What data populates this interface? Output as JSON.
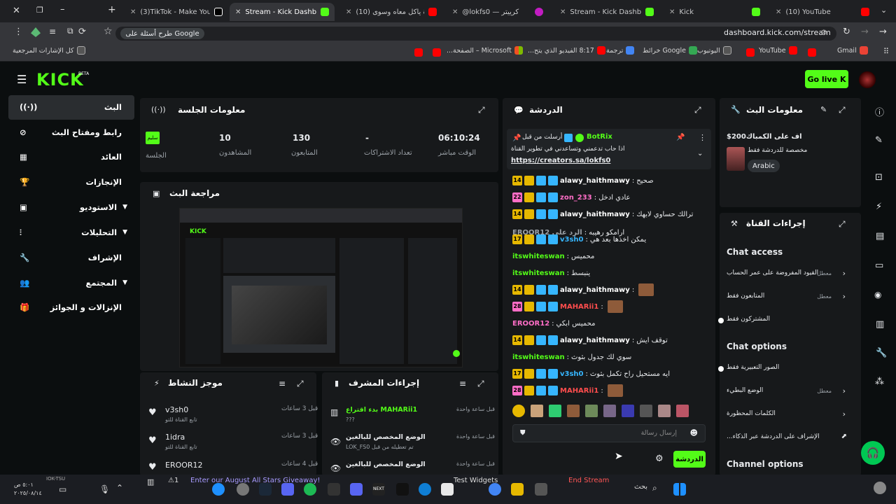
{
  "browser": {
    "tabs": [
      {
        "label": "(3)TikTok - Make Your Da",
        "active": false
      },
      {
        "label": "Stream - Kick Dashboard",
        "active": true
      },
      {
        "label": "(10) ناداة ياكل معاه وسوى",
        "active": false
      },
      {
        "label": "@lokfs0 — كرييتر",
        "active": false
      },
      {
        "label": "Stream - Kick Dashboard",
        "active": false
      },
      {
        "label": "Kick",
        "active": false
      },
      {
        "label": "(10) YouTube",
        "active": false
      }
    ],
    "url": "dashboard.kick.com/stream",
    "search_prompt": "Google طرح أسئلة على",
    "bookmarks": [
      "Gmail",
      "YouTube",
      "اليوتيوب",
      "Google خرائط",
      "ترجمة",
      "8:17 الفيديو الذي يتح...",
      "Microsoft – الصفحة...",
      "كل الإشارات المرجعية"
    ]
  },
  "header": {
    "logo": "KICK",
    "beta": "BETA",
    "go_live": "Go live"
  },
  "sidebar": [
    {
      "label": "البث",
      "icon": "broadcast-icon",
      "active": true
    },
    {
      "label": "رابط ومفتاح البث",
      "icon": "link-icon"
    },
    {
      "label": "العائد",
      "icon": "chart-icon"
    },
    {
      "label": "الإنجازات",
      "icon": "trophy-icon"
    },
    {
      "label": "الاستوديو",
      "icon": "studio-icon",
      "chevron": true
    },
    {
      "label": "التحليلات",
      "icon": "analytics-icon",
      "chevron": true
    },
    {
      "label": "الإشراف",
      "icon": "wrench-icon"
    },
    {
      "label": "المجتمع",
      "icon": "community-icon",
      "chevron": true
    },
    {
      "label": "الإنزالات و الجوائز",
      "icon": "gift-icon"
    }
  ],
  "session": {
    "title": "معلومات الجلسة",
    "stats": [
      {
        "value": "06:10:24",
        "label": "الوقت مباشر"
      },
      {
        "value": "-",
        "label": "تعداد الاشتراكات"
      },
      {
        "value": "130",
        "label": "المتابعون"
      },
      {
        "value": "10",
        "label": "المشاهدون"
      },
      {
        "value": "سليم",
        "label": "الجلسة"
      }
    ]
  },
  "preview": {
    "title": "مراجعة البث"
  },
  "activity": {
    "title": "موجز النشاط",
    "items": [
      {
        "user": "v3sh0",
        "sub": "تابع القناة للتو",
        "time": "قبل 3 ساعات"
      },
      {
        "user": "1idra",
        "sub": "تابع القناة للتو",
        "time": "قبل 3 ساعات"
      },
      {
        "user": "EROOR12",
        "sub": "",
        "time": "قبل 4 ساعات"
      }
    ]
  },
  "moderation": {
    "title": "إجراءات المشرف",
    "items": [
      {
        "line1": "MAHARii1 بدء اقتراع",
        "line2": "???",
        "time": "قبل ساعة واحدة"
      },
      {
        "line1": "الوضع المخصص للبالغين",
        "line2": "تم تعطيله من قبل LOK_FS0",
        "time": "قبل ساعة واحدة"
      },
      {
        "line1": "الوضع المخصص للبالغين",
        "line2": "",
        "time": "قبل ساعة واحدة"
      }
    ]
  },
  "chat": {
    "title": "الدردشة",
    "pinned": {
      "by": "أرسلت من قبل",
      "user": "BotRix",
      "text": "اذا حاب تدعمني وتساعدني في تطوير القناة",
      "link": "https://creators.sa/lokfs0"
    },
    "messages": [
      {
        "badge": "14",
        "user": "alawy_haithmawy",
        "color": "#ffffff",
        "text": "صحيح"
      },
      {
        "badge": "22",
        "user": "zon_233",
        "color": "#ff6ec7",
        "text": "عادي ادخل"
      },
      {
        "badge": "14",
        "user": "alawy_haithmawy",
        "color": "#ffffff",
        "text": "ترالك حساوي لابهك"
      },
      {
        "badge": "",
        "user": "EROOR12 الرد على",
        "color": "#9aa0a6",
        "text": "ارامكو رهيبه"
      },
      {
        "badge": "17",
        "user": "v3sh0",
        "color": "#36b6ff",
        "text": "يمكن اخذها بعد هي"
      },
      {
        "badge": "",
        "user": "itswhiteswan",
        "color": "#53fc18",
        "text": "محميس"
      },
      {
        "badge": "",
        "user": "itswhiteswan",
        "color": "#53fc18",
        "text": "ينبسط"
      },
      {
        "badge": "14",
        "user": "alawy_haithmawy",
        "color": "#ffffff",
        "text": ""
      },
      {
        "badge": "28",
        "user": "MAHARii1",
        "color": "#ff4d4d",
        "text": ""
      },
      {
        "badge": "",
        "user": "EROOR12",
        "color": "#ff6ec7",
        "text": "محميس ابكي"
      },
      {
        "badge": "14",
        "user": "alawy_haithmawy",
        "color": "#ffffff",
        "text": "توقف ايش"
      },
      {
        "badge": "",
        "user": "itswhiteswan",
        "color": "#53fc18",
        "text": "سوي لك جدول بثوث"
      },
      {
        "badge": "17",
        "user": "v3sh0",
        "color": "#36b6ff",
        "text": "ايه مستحيل راح تكمل بثوث"
      },
      {
        "badge": "28",
        "user": "MAHARii1",
        "color": "#ff4d4d",
        "text": ""
      }
    ],
    "input_placeholder": "إرسال رسالة",
    "send_label": "الدردشة"
  },
  "stream_info": {
    "title": "معلومات البث",
    "stream_title": "اف على الكمباك200$",
    "subtitle": "مخصصة للدردشة فقط",
    "language": "Arabic"
  },
  "channel_actions": {
    "title": "إجراءات القناة",
    "chat_access_title": "Chat access",
    "chat_access": [
      {
        "label": "القيود المفروضة على عمر الحساب",
        "state": "معطل",
        "type": "chevron"
      },
      {
        "label": "المتابعون فقط",
        "state": "معطل",
        "type": "chevron"
      },
      {
        "label": "المشتركون فقط",
        "state": "",
        "type": "toggle"
      }
    ],
    "chat_options_title": "Chat options",
    "chat_options": [
      {
        "label": "الصور التعبيرية فقط",
        "state": "",
        "type": "toggle"
      },
      {
        "label": "الوضع البطيء",
        "state": "معطل",
        "type": "chevron"
      },
      {
        "label": "الكلمات المحظورة",
        "state": "",
        "type": "chevron"
      },
      {
        "label": "الإشراف على الدردشة عبر الذكاء...",
        "state": "",
        "type": "external"
      }
    ],
    "channel_options_title": "Channel options"
  },
  "taskbar": {
    "clock": "٥:٠١ ص",
    "date": "٢٠٢٥/٠٨/١٤",
    "promo": "Enter our August All Stars Giveaway!",
    "widget": "Test Widgets",
    "end_stream": "End Stream",
    "search": "بحث"
  },
  "colors": {
    "accent": "#53fc18",
    "panel": "#17191b",
    "bg": "#0b0e0f"
  }
}
